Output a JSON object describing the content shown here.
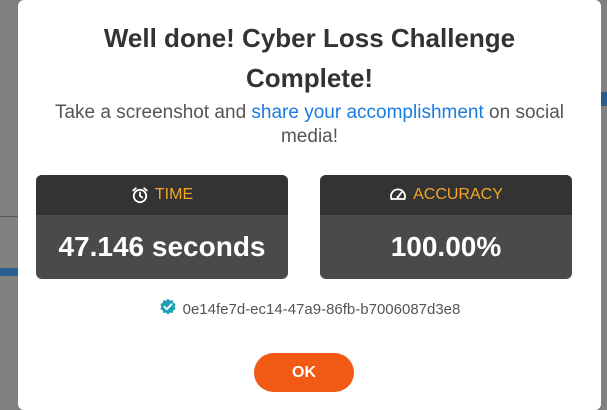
{
  "modal": {
    "title": "Well done! Cyber Loss Challenge Complete!",
    "subtitle_before": "Take a screenshot and ",
    "subtitle_link": "share your accomplishment",
    "subtitle_after": " on social media!",
    "time": {
      "label": "TIME",
      "icon": "alarm-clock-icon",
      "value": "47.146 seconds"
    },
    "accuracy": {
      "label": "ACCURACY",
      "icon": "gauge-icon",
      "value": "100.00%"
    },
    "verification_id": "0e14fe7d-ec14-47a9-86fb-b7006087d3e8",
    "verification_icon": "verified-badge-icon",
    "ok_label": "OK"
  },
  "colors": {
    "accent_orange": "#f05a14",
    "label_amber": "#f5a623",
    "link_blue": "#1a7be0",
    "card_bg": "#4a4a4a",
    "card_header": "#333333",
    "badge_teal": "#1da1b8"
  }
}
